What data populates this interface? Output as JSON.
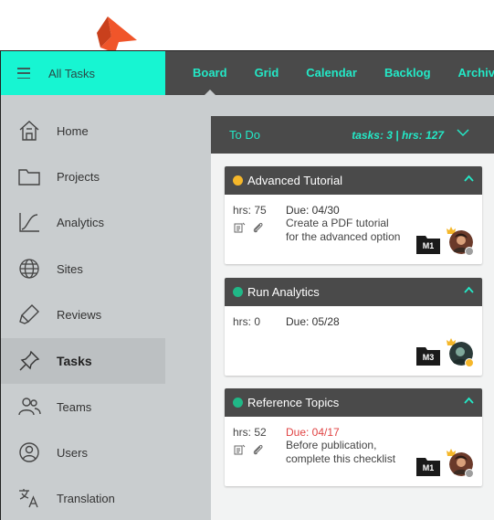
{
  "header": {
    "menu_icon": "hamburger-icon",
    "title": "All Tasks",
    "tabs": [
      {
        "label": "Board",
        "active": true
      },
      {
        "label": "Grid"
      },
      {
        "label": "Calendar"
      },
      {
        "label": "Backlog"
      },
      {
        "label": "Archive"
      }
    ]
  },
  "sidebar": {
    "items": [
      {
        "label": "Home",
        "icon": "home-icon"
      },
      {
        "label": "Projects",
        "icon": "folder-icon"
      },
      {
        "label": "Analytics",
        "icon": "analytics-chart-icon"
      },
      {
        "label": "Sites",
        "icon": "globe-icon"
      },
      {
        "label": "Reviews",
        "icon": "highlighter-icon"
      },
      {
        "label": "Tasks",
        "icon": "pushpin-icon",
        "active": true
      },
      {
        "label": "Teams",
        "icon": "people-icon"
      },
      {
        "label": "Users",
        "icon": "user-circle-icon"
      },
      {
        "label": "Translation",
        "icon": "translate-icon"
      }
    ]
  },
  "column": {
    "title": "To Do",
    "stats": "tasks: 3 | hrs: 127",
    "chevron_icon": "chevron-down-icon"
  },
  "cards": [
    {
      "title": "Advanced Tutorial",
      "status_color": "#f5b72a",
      "hrs": "hrs: 75",
      "due": "Due: 04/30",
      "overdue": false,
      "description": "Create a PDF tutorial for the advanced option",
      "badge": "M1",
      "has_attachments": true,
      "avatar_status_color": "#9e9e9e"
    },
    {
      "title": "Run Analytics",
      "status_color": "#20b887",
      "hrs": "hrs: 0",
      "due": "Due: 05/28",
      "overdue": false,
      "description": "",
      "badge": "M3",
      "has_attachments": false,
      "avatar_status_color": "#f5b72a"
    },
    {
      "title": "Reference Topics",
      "status_color": "#20b887",
      "hrs": "hrs: 52",
      "due": "Due: 04/17",
      "overdue": true,
      "description": "Before publication, complete this checklist",
      "badge": "M1",
      "has_attachments": true,
      "avatar_status_color": "#9e9e9e"
    }
  ],
  "colors": {
    "accent": "#17f5d2",
    "accent_text": "#23e9c7",
    "dark": "#4a4a4a",
    "sidebar_bg": "#c9cdcf",
    "overdue": "#e04343",
    "pointer": "#f0552a"
  }
}
